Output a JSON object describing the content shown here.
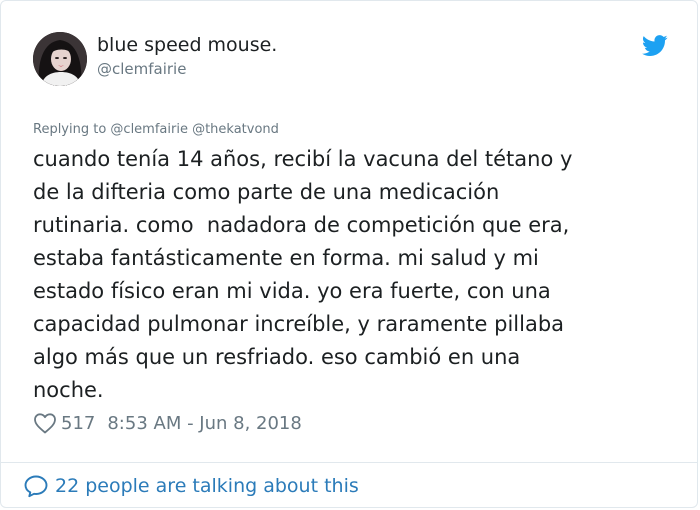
{
  "author": {
    "display_name": "blue speed mouse.",
    "handle": "@clemfairie",
    "avatar_icon": "profile-photo"
  },
  "reply_context": "Replying to @clemfairie @thekatvond",
  "tweet": {
    "text_lines": [
      "cuando tenía 14 años, recibí la vacuna del tétano y",
      "de la difteria como parte de una medicación",
      "rutinaria. como  nadadora de competición que era,",
      "estaba fantásticamente en forma. mi salud y mi",
      "estado físico eran mi vida. yo era fuerte, con una",
      "capacidad pulmonar increíble, y raramente pillaba",
      "algo más que un resfriado. eso cambió en una",
      "noche."
    ],
    "likes": "517",
    "timestamp": "8:53 AM - Jun 8, 2018"
  },
  "footer": {
    "talking_text": "22 people are talking about this"
  },
  "colors": {
    "twitter_blue": "#1da1f2",
    "link_blue": "#2b7bb9",
    "text_primary": "#1c2022",
    "text_secondary": "#697882"
  },
  "icons": {
    "brand": "twitter-bird-icon",
    "like": "heart-icon",
    "conversation": "speech-bubble-icon"
  }
}
